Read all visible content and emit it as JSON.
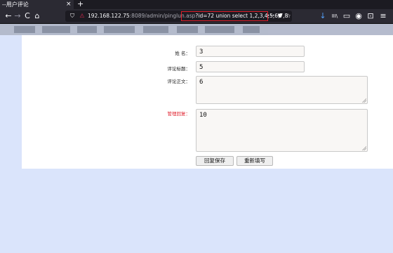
{
  "tab": {
    "title": "--用户评论",
    "close": "×",
    "new": "+"
  },
  "nav": {
    "back": "←",
    "forward": "→",
    "reload": "C",
    "home": "⌂",
    "url_host": "192.168.122.75",
    "url_path": ":8089/admin/pinglun.asp",
    "url_query": "?id=72 union select 1,2,3,4,5,6,7,8",
    "menu": "•••",
    "right_icons": [
      "↓",
      "III\\",
      "▭",
      "◉",
      "⊡",
      "≡"
    ]
  },
  "form": {
    "name_label": "姓 名：",
    "name_value": "3",
    "title_label": "评论标题：",
    "title_value": "5",
    "content_label": "评论正文：",
    "content_value": "6",
    "reply_label": "管理回复：",
    "reply_value": "10",
    "save_button": "回复保存",
    "reset_button": "重新填写"
  },
  "colors": {
    "page_bg": "#dae4fb",
    "highlight": "#e01e2a",
    "required_label": "#e0222e"
  }
}
